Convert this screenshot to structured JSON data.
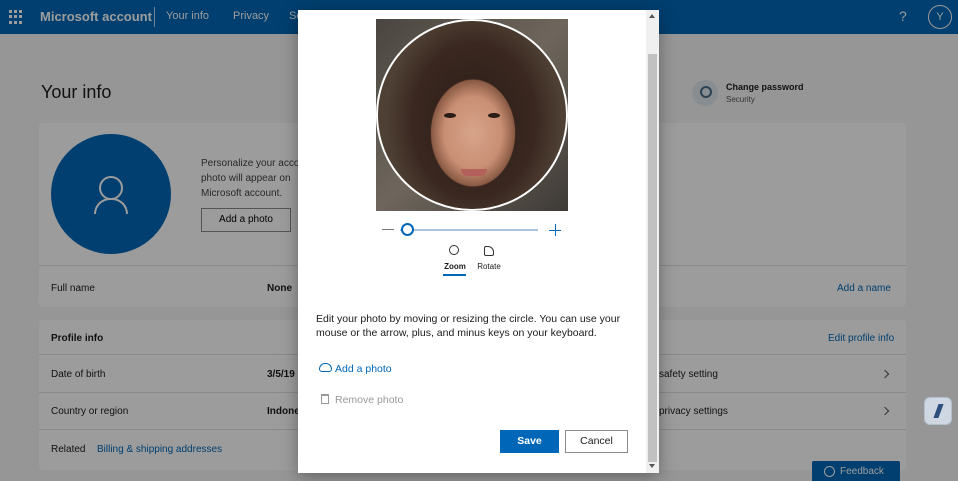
{
  "topbar": {
    "brand": "Microsoft account",
    "nav": [
      "Your info",
      "Privacy",
      "Se"
    ],
    "help": "?",
    "avatar_initial": "Y"
  },
  "page": {
    "title": "Your info",
    "change_password": {
      "label": "Change password",
      "sub": "Security"
    },
    "profile_card": {
      "personalize_lines": [
        "Personalize your acco",
        "photo will appear on",
        "Microsoft account."
      ],
      "add_photo_button": "Add a photo",
      "full_name_label": "Full name",
      "full_name_value": "None",
      "add_name_link": "Add a name"
    },
    "profile_info": {
      "heading": "Profile info",
      "edit_link": "Edit profile info",
      "rows": [
        {
          "label": "Date of birth",
          "value": "3/5/19",
          "right": "safety setting"
        },
        {
          "label": "Country or region",
          "value": "Indone",
          "right": "privacy settings"
        }
      ],
      "related_label": "Related",
      "related_link": "Billing & shipping addresses"
    },
    "feedback": "Feedback"
  },
  "dialog": {
    "tabs": [
      "Zoom",
      "Rotate"
    ],
    "instructions": "Edit your photo by moving or resizing the circle. You can use your mouse or the arrow, plus, and minus keys on your keyboard.",
    "add_photo_link": "Add a photo",
    "remove_photo_link": "Remove photo",
    "save": "Save",
    "cancel": "Cancel",
    "zoom_level": 0.05
  }
}
